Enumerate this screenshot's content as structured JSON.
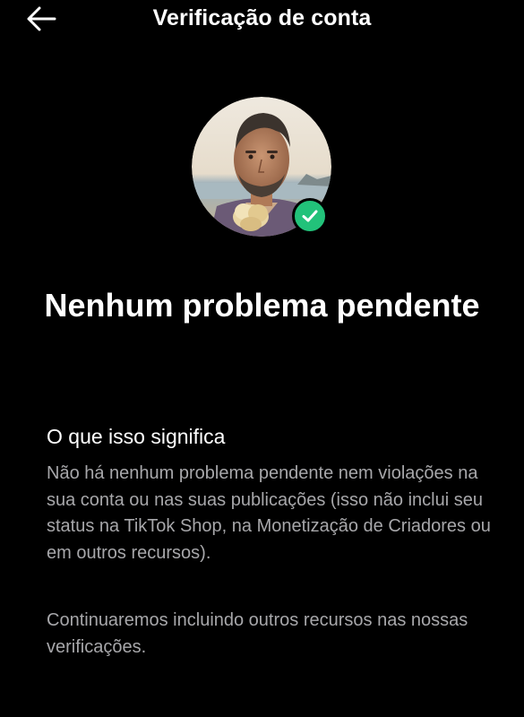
{
  "header": {
    "title": "Verificação de conta",
    "back_icon": "arrow-left-icon"
  },
  "status": {
    "headline": "Nenhum problema pendente",
    "badge_icon": "check-circle-icon",
    "badge_color": "#22c27a"
  },
  "info": {
    "section_title": "O que isso significa",
    "paragraph_1": "Não há nenhum problema pendente nem violações na sua conta ou nas suas publicações (isso não inclui seu status na TikTok Shop, na Monetização de Criadores ou em outros recursos).",
    "paragraph_2": "Continuaremos incluindo outros recursos nas nossas verificações."
  }
}
